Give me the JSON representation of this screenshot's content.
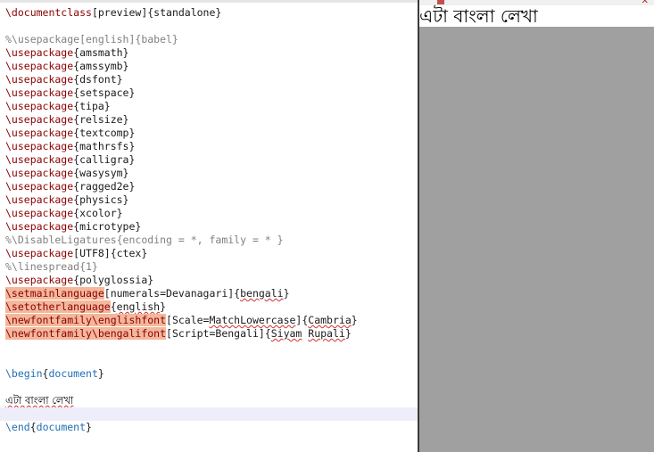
{
  "editor": {
    "lines": [
      [
        {
          "t": "cmd",
          "v": "\\documentclass"
        },
        {
          "t": "arg",
          "v": "[preview]{standalone}"
        }
      ],
      [],
      [
        {
          "t": "com",
          "v": "%\\usepackage[english]{babel}"
        }
      ],
      [
        {
          "t": "cmd",
          "v": "\\usepackage"
        },
        {
          "t": "arg",
          "v": "{amsmath}"
        }
      ],
      [
        {
          "t": "cmd",
          "v": "\\usepackage"
        },
        {
          "t": "arg",
          "v": "{amssymb}"
        }
      ],
      [
        {
          "t": "cmd",
          "v": "\\usepackage"
        },
        {
          "t": "arg",
          "v": "{dsfont}"
        }
      ],
      [
        {
          "t": "cmd",
          "v": "\\usepackage"
        },
        {
          "t": "arg",
          "v": "{setspace}"
        }
      ],
      [
        {
          "t": "cmd",
          "v": "\\usepackage"
        },
        {
          "t": "arg",
          "v": "{tipa}"
        }
      ],
      [
        {
          "t": "cmd",
          "v": "\\usepackage"
        },
        {
          "t": "arg",
          "v": "{relsize}"
        }
      ],
      [
        {
          "t": "cmd",
          "v": "\\usepackage"
        },
        {
          "t": "arg",
          "v": "{textcomp}"
        }
      ],
      [
        {
          "t": "cmd",
          "v": "\\usepackage"
        },
        {
          "t": "arg",
          "v": "{mathrsfs}"
        }
      ],
      [
        {
          "t": "cmd",
          "v": "\\usepackage"
        },
        {
          "t": "arg",
          "v": "{calligra}"
        }
      ],
      [
        {
          "t": "cmd",
          "v": "\\usepackage"
        },
        {
          "t": "arg",
          "v": "{wasysym}"
        }
      ],
      [
        {
          "t": "cmd",
          "v": "\\usepackage"
        },
        {
          "t": "arg",
          "v": "{ragged2e}"
        }
      ],
      [
        {
          "t": "cmd",
          "v": "\\usepackage"
        },
        {
          "t": "arg",
          "v": "{physics}"
        }
      ],
      [
        {
          "t": "cmd",
          "v": "\\usepackage"
        },
        {
          "t": "arg",
          "v": "{xcolor}"
        }
      ],
      [
        {
          "t": "cmd",
          "v": "\\usepackage"
        },
        {
          "t": "arg",
          "v": "{microtype}"
        }
      ],
      [
        {
          "t": "com",
          "v": "%\\DisableLigatures{encoding = *, family = * }"
        }
      ],
      [
        {
          "t": "cmd",
          "v": "\\usepackage"
        },
        {
          "t": "arg",
          "v": "[UTF8]{ctex}"
        }
      ],
      [
        {
          "t": "com",
          "v": "%\\linespread{1}"
        }
      ],
      [
        {
          "t": "cmd",
          "v": "\\usepackage"
        },
        {
          "t": "arg",
          "v": "{polyglossia}"
        }
      ],
      [
        {
          "t": "cmd",
          "v": "\\setmainlanguage",
          "hl": true
        },
        {
          "t": "arg",
          "v": "[numerals=Devanagari]{"
        },
        {
          "t": "arg",
          "v": "bengali",
          "sq": true
        },
        {
          "t": "arg",
          "v": "}"
        }
      ],
      [
        {
          "t": "cmd",
          "v": "\\setotherlanguage",
          "hl": true
        },
        {
          "t": "arg",
          "v": "{"
        },
        {
          "t": "arg",
          "v": "english",
          "sq": true
        },
        {
          "t": "arg",
          "v": "}"
        }
      ],
      [
        {
          "t": "cmd",
          "v": "\\newfontfamily\\englishfont",
          "hl": true
        },
        {
          "t": "arg",
          "v": "[Scale="
        },
        {
          "t": "arg",
          "v": "MatchLowercase",
          "sq": true
        },
        {
          "t": "arg",
          "v": "]{"
        },
        {
          "t": "arg",
          "v": "Cambria",
          "sq": true
        },
        {
          "t": "arg",
          "v": "}"
        }
      ],
      [
        {
          "t": "cmd",
          "v": "\\newfontfamily\\bengalifont",
          "hl": true
        },
        {
          "t": "arg",
          "v": "[Script=Bengali]{"
        },
        {
          "t": "arg",
          "v": "Siyam",
          "sq": true
        },
        {
          "t": "arg",
          "v": " "
        },
        {
          "t": "arg",
          "v": "Rupali",
          "sq": true
        },
        {
          "t": "arg",
          "v": "}"
        }
      ],
      [],
      [],
      [
        {
          "t": "env",
          "v": "\\begin"
        },
        {
          "t": "arg",
          "v": "{"
        },
        {
          "t": "env",
          "v": "document"
        },
        {
          "t": "arg",
          "v": "}"
        }
      ],
      [],
      [
        {
          "t": "bengali",
          "v": "এটা বাংলা লেখা",
          "sq": true
        }
      ],
      [],
      [
        {
          "t": "env",
          "v": "\\end"
        },
        {
          "t": "arg",
          "v": "{"
        },
        {
          "t": "env",
          "v": "document"
        },
        {
          "t": "arg",
          "v": "}"
        }
      ]
    ],
    "current_line_index": 30
  },
  "preview": {
    "text": "এটা বাংলা লেখা",
    "close_glyph": "✕"
  },
  "colors": {
    "command": "#8b0000",
    "comment": "#808080",
    "environment": "#1e6fb5",
    "highlight": "#f4b79c",
    "current_line": "#eeeefa",
    "preview_background": "#a0a0a0"
  }
}
